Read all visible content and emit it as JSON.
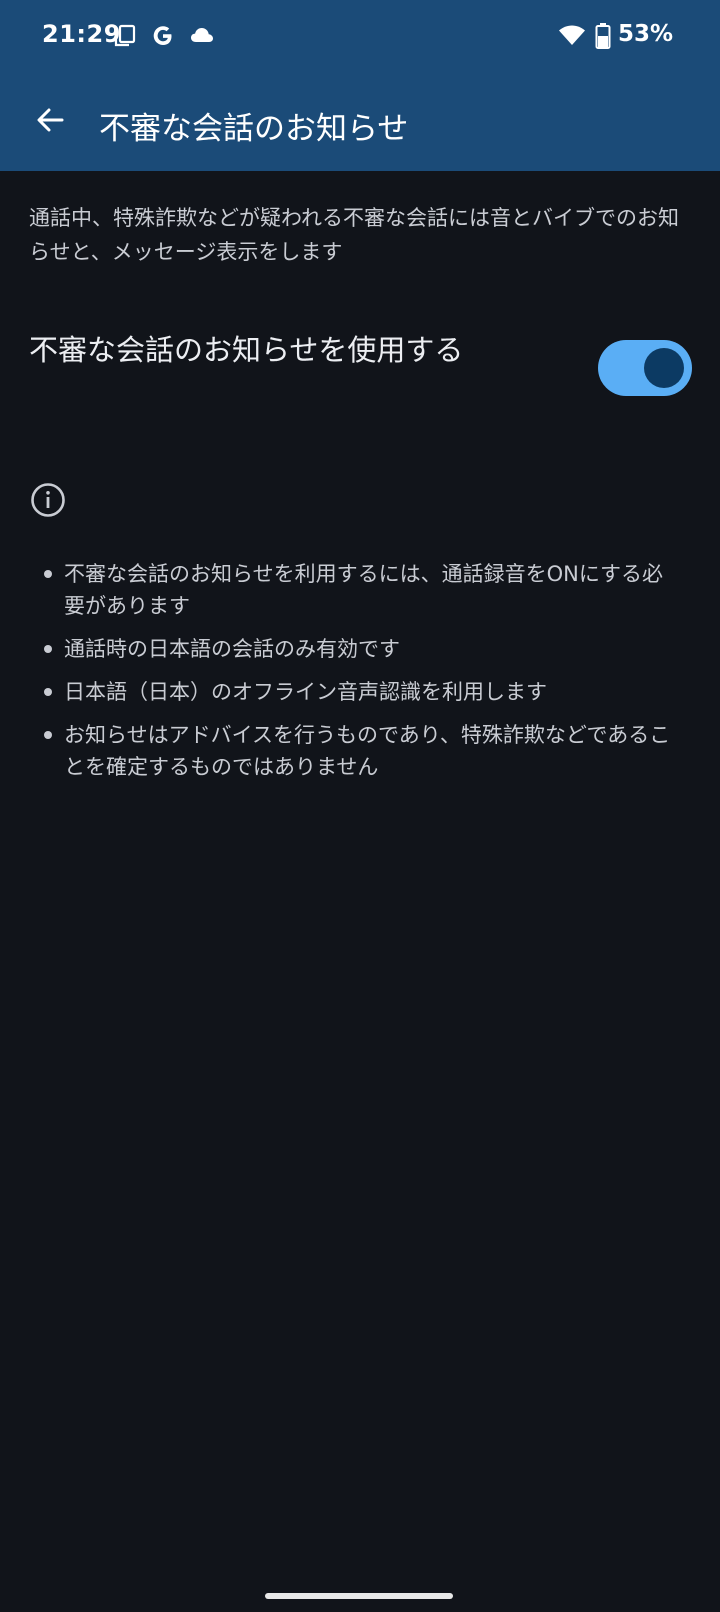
{
  "statusbar": {
    "time": "21:29",
    "battery": "53%",
    "icons": [
      "screenshot-icon",
      "google-g-icon",
      "cloud-icon",
      "wifi-icon",
      "battery-icon"
    ]
  },
  "appbar": {
    "title": "不審な会話のお知らせ",
    "back_icon": "arrow-back-icon",
    "color": "#1b4b78"
  },
  "description": "通話中、特殊詐欺などが疑われる不審な会話には音とバイブでのお知らせと、メッセージ表示をします",
  "setting": {
    "label": "不審な会話のお知らせを使用する",
    "enabled": true,
    "toggle_color": "#5aaef5"
  },
  "info": {
    "icon": "info-icon",
    "bullets": [
      "不審な会話のお知らせを利用するには、通話録音をONにする必要があります",
      "通話時の日本語の会話のみ有効です",
      "日本語（日本）のオフライン音声認識を利用します",
      "お知らせはアドバイスを行うものであり、特殊詐欺などであることを確定するものではありません"
    ]
  },
  "background": "#11141a"
}
